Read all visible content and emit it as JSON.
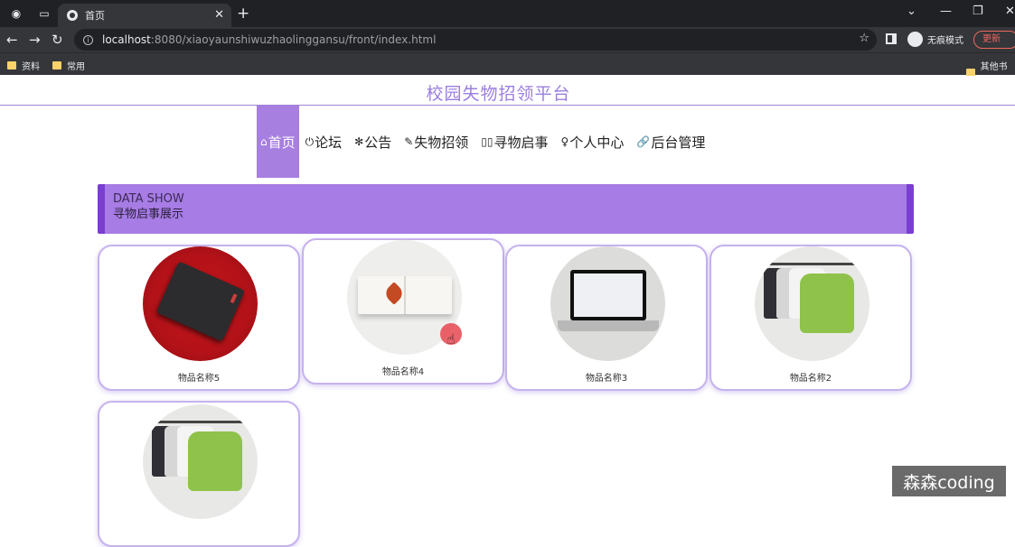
{
  "browser": {
    "tab_title": "首页",
    "url_host": "localhost",
    "url_rest": ":8080/xiaoyaunshiwuzhaolinggansu/front/index.html",
    "incognito_label": "无痕模式",
    "update_label": "更新",
    "bookmarks": [
      "资料",
      "常用"
    ],
    "other_bookmarks": "其他书签"
  },
  "site": {
    "title": "校园失物招领平台",
    "menu": [
      {
        "icon": "home-icon",
        "glyph": "⌂",
        "label": "首页"
      },
      {
        "icon": "power-icon",
        "glyph": "⏻",
        "label": "论坛"
      },
      {
        "icon": "snowflake-icon",
        "glyph": "✻",
        "label": "公告"
      },
      {
        "icon": "feather-icon",
        "glyph": "✎",
        "label": "失物招领"
      },
      {
        "icon": "book-icon",
        "glyph": "▯▯",
        "label": "寻物启事"
      },
      {
        "icon": "user-icon",
        "glyph": "♀",
        "label": "个人中心"
      },
      {
        "icon": "link-icon",
        "glyph": "🔗",
        "label": "后台管理"
      }
    ]
  },
  "banner": {
    "en": "DATA SHOW",
    "cn": "寻物启事展示"
  },
  "items": [
    {
      "name": "物品名称5"
    },
    {
      "name": "物品名称4"
    },
    {
      "name": "物品名称3"
    },
    {
      "name": "物品名称2"
    },
    {
      "name": ""
    }
  ],
  "watermark": "森森coding",
  "colors": {
    "accent": "#a77ce5",
    "accent_dark": "#7a3ed3",
    "title": "#9b7ee0"
  }
}
